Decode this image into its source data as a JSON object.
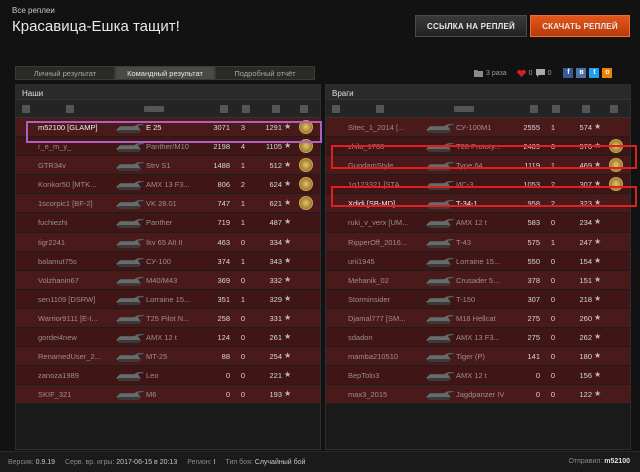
{
  "breadcrumb": "Все реплеи",
  "title": "Красавица-Ешка тащит!",
  "buttons": {
    "link": "ССЫЛКА НА РЕПЛЕЙ",
    "download": "СКАЧАТЬ РЕПЛЕЙ"
  },
  "tabs": [
    "Личный результат",
    "Командный результат",
    "Подробный отчёт"
  ],
  "stats": {
    "downloads": "3 раза",
    "likes": "0",
    "comments": "0"
  },
  "teams": {
    "left": {
      "label": "Наши"
    },
    "right": {
      "label": "Враги"
    }
  },
  "allies": [
    {
      "name": "m52100 [GLAMP]",
      "tank": "E 25",
      "damage": "3071",
      "kills": "3",
      "xp": "1291",
      "medal": true
    },
    {
      "name": "r_e_m_y_",
      "tank": "Panther/M10",
      "damage": "2198",
      "kills": "4",
      "xp": "1105",
      "medal": true
    },
    {
      "name": "GTR34v",
      "tank": "Strv S1",
      "damage": "1488",
      "kills": "1",
      "xp": "512",
      "medal": true
    },
    {
      "name": "Konkor50 [MTK...",
      "tank": "AMX 13 F3...",
      "damage": "806",
      "kills": "2",
      "xp": "624",
      "medal": true
    },
    {
      "name": "1scorpic1 [BF-2]",
      "tank": "VK 28.01",
      "damage": "747",
      "kills": "1",
      "xp": "621",
      "medal": true
    },
    {
      "name": "fuchiezhi",
      "tank": "Panther",
      "damage": "719",
      "kills": "1",
      "xp": "487",
      "medal": false
    },
    {
      "name": "tigr2241",
      "tank": "Ikv 65 Alt II",
      "damage": "463",
      "kills": "0",
      "xp": "334",
      "medal": false
    },
    {
      "name": "balamut75s",
      "tank": "СУ-100",
      "damage": "374",
      "kills": "1",
      "xp": "343",
      "medal": false
    },
    {
      "name": "Volzhanin67",
      "tank": "M40/M43",
      "damage": "369",
      "kills": "0",
      "xp": "332",
      "medal": false
    },
    {
      "name": "sen1109 [DSRW]",
      "tank": "Lorraine 15...",
      "damage": "351",
      "kills": "1",
      "xp": "329",
      "medal": false
    },
    {
      "name": "Warrior9111 [E-I...",
      "tank": "T25 Pilot N...",
      "damage": "258",
      "kills": "0",
      "xp": "331",
      "medal": false
    },
    {
      "name": "gordei4new",
      "tank": "AMX 12 t",
      "damage": "124",
      "kills": "0",
      "xp": "261",
      "medal": false
    },
    {
      "name": "RenamedUser_2...",
      "tank": "MT-25",
      "damage": "88",
      "kills": "0",
      "xp": "254",
      "medal": false
    },
    {
      "name": "zanoza1989",
      "tank": "Leo",
      "damage": "0",
      "kills": "0",
      "xp": "221",
      "medal": false
    },
    {
      "name": "SKIF_321",
      "tank": "M6",
      "damage": "0",
      "kills": "0",
      "xp": "193",
      "medal": false
    }
  ],
  "enemies": [
    {
      "name": "Sitec_1_2014 [...",
      "tank": "СУ-100М1",
      "damage": "2555",
      "kills": "1",
      "xp": "574",
      "medal": false
    },
    {
      "name": "zhila_1708",
      "tank": "T28 Prototy...",
      "damage": "2489",
      "kills": "6",
      "xp": "576",
      "medal": true
    },
    {
      "name": "GundamStyle",
      "tank": "Type 64",
      "damage": "1119",
      "kills": "1",
      "xp": "469",
      "medal": true
    },
    {
      "name": "1q123321 [STA...",
      "tank": "ИС-3",
      "damage": "1053",
      "kills": "2",
      "xp": "307",
      "medal": true
    },
    {
      "name": "Xdidi [SB-MD]",
      "tank": "T-34-1",
      "damage": "958",
      "kills": "2",
      "xp": "323",
      "medal": false
    },
    {
      "name": "ruki_v_verx [UM...",
      "tank": "AMX 12 t",
      "damage": "583",
      "kills": "0",
      "xp": "234",
      "medal": false
    },
    {
      "name": "RipperOff_2016...",
      "tank": "T-43",
      "damage": "575",
      "kills": "1",
      "xp": "247",
      "medal": false
    },
    {
      "name": "urii1945",
      "tank": "Lorraine 15...",
      "damage": "550",
      "kills": "0",
      "xp": "154",
      "medal": false
    },
    {
      "name": "Mehanik_02",
      "tank": "Crusader 5...",
      "damage": "378",
      "kills": "0",
      "xp": "151",
      "medal": false
    },
    {
      "name": "Storminsider",
      "tank": "T-150",
      "damage": "307",
      "kills": "0",
      "xp": "218",
      "medal": false
    },
    {
      "name": "Djamal777 [SM...",
      "tank": "M18 Hellcat",
      "damage": "275",
      "kills": "0",
      "xp": "260",
      "medal": false
    },
    {
      "name": "sdadon",
      "tank": "AMX 13 F3...",
      "damage": "275",
      "kills": "0",
      "xp": "262",
      "medal": false
    },
    {
      "name": "mamba210510",
      "tank": "Tiger (P)",
      "damage": "141",
      "kills": "0",
      "xp": "180",
      "medal": false
    },
    {
      "name": "BepTolo3",
      "tank": "AMX 12 t",
      "damage": "0",
      "kills": "0",
      "xp": "156",
      "medal": false
    },
    {
      "name": "max3_2015",
      "tank": "Jagdpanzer IV",
      "damage": "0",
      "kills": "0",
      "xp": "122",
      "medal": false
    }
  ],
  "footer": {
    "version_label": "Версия:",
    "version": "0.9.19",
    "server_time_label": "Серв. вр. игры:",
    "server_time": "2017-06-15 в 20:13",
    "region_label": "Регион:",
    "region": "I",
    "battle_type_label": "Тип боя:",
    "battle_type": "Случайный бой",
    "sender_label": "Отправил:",
    "sender": "m52100"
  },
  "colors": {
    "accent": "#e4571a",
    "highlight_player": "#b05ec2",
    "highlight_enemy": "#e02020"
  }
}
